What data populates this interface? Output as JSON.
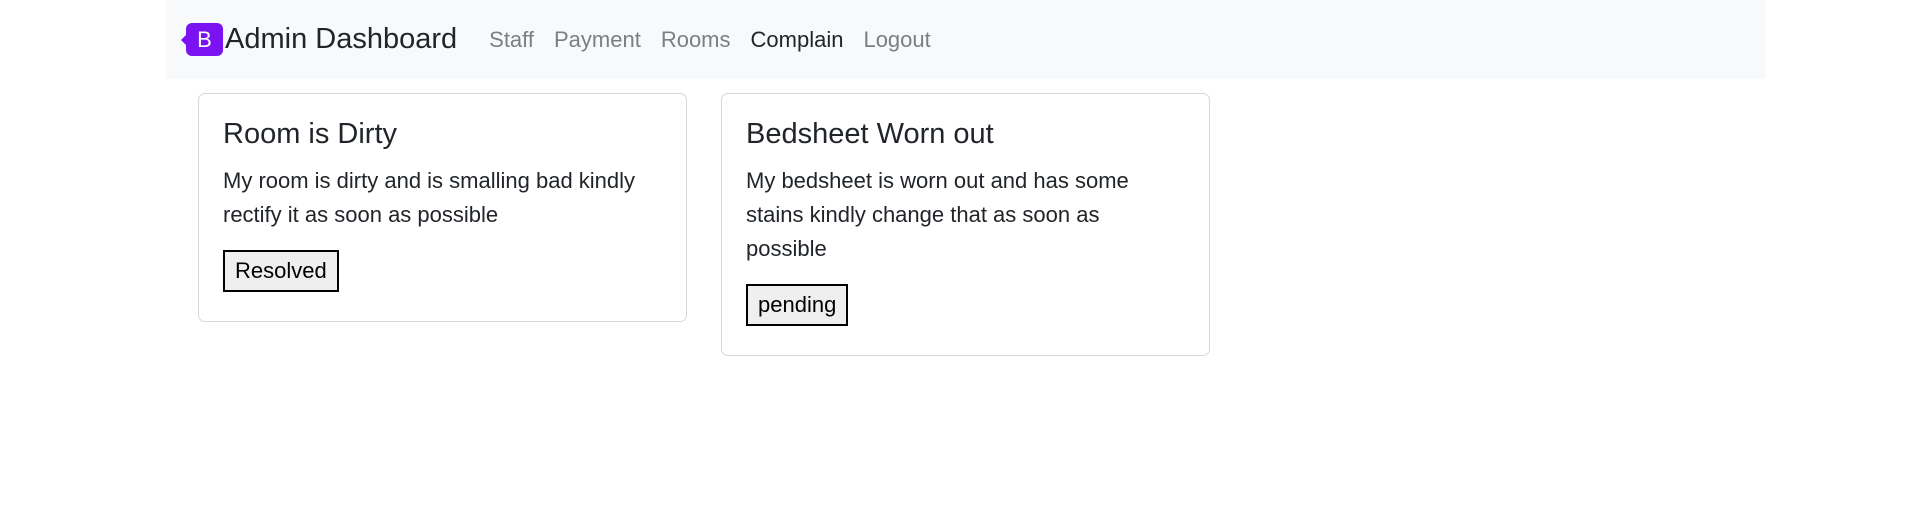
{
  "navbar": {
    "logo_letter": "B",
    "brand": "Admin Dashboard",
    "links": [
      {
        "label": "Staff",
        "active": false
      },
      {
        "label": "Payment",
        "active": false
      },
      {
        "label": "Rooms",
        "active": false
      },
      {
        "label": "Complain",
        "active": true
      },
      {
        "label": "Logout",
        "active": false
      }
    ]
  },
  "colors": {
    "brand_accent": "#7a12f2",
    "navbar_bg": "#f8f9fa",
    "nav_inactive": "#7a7f84",
    "nav_active": "#212529"
  },
  "complaints": [
    {
      "title": "Room is Dirty",
      "description": "My room is dirty and is smalling bad kindly rectify it as soon as possible",
      "status": "Resolved"
    },
    {
      "title": "Bedsheet Worn out",
      "description": "My bedsheet is worn out and has some stains kindly change that as soon as possible",
      "status": "pending"
    }
  ]
}
